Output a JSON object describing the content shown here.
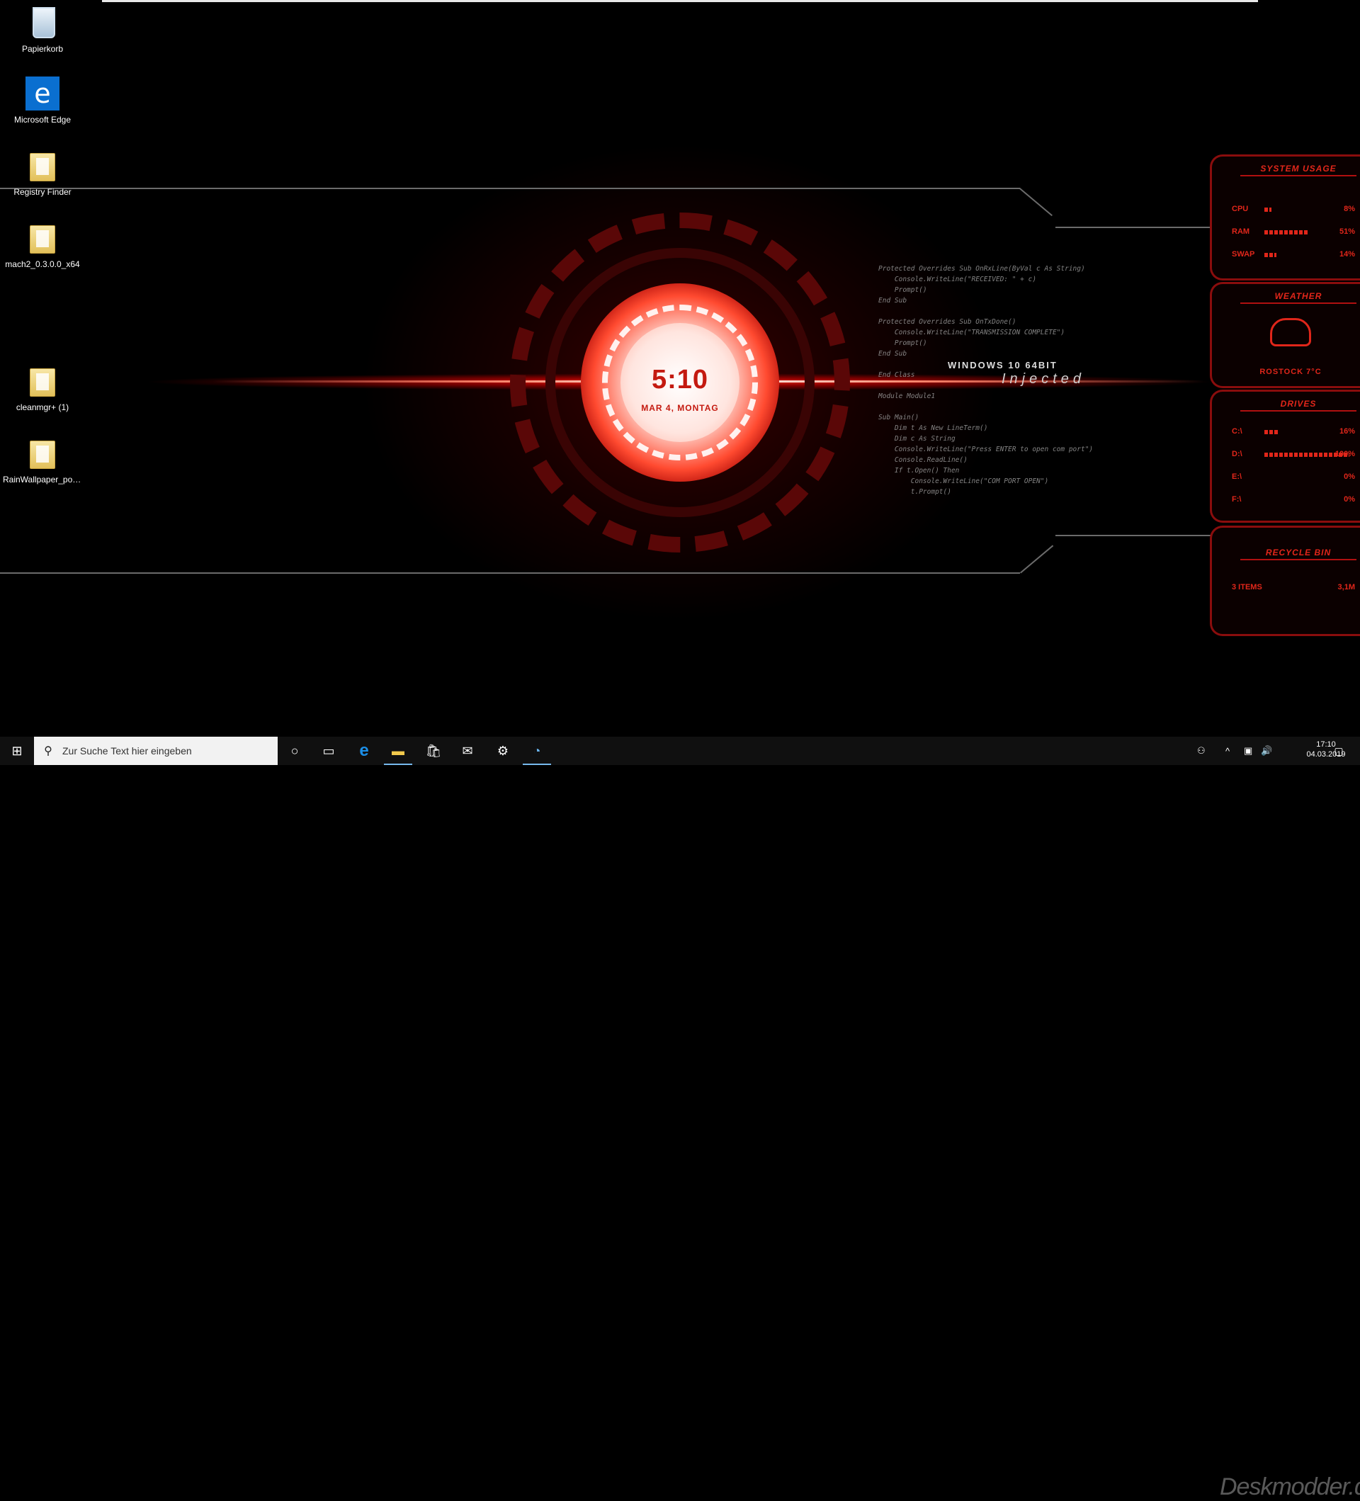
{
  "desktop_icons": [
    {
      "label": "Papierkorb",
      "icon": "recycle-bin-icon"
    },
    {
      "label": "Microsoft Edge",
      "icon": "edge-icon"
    },
    {
      "label": "Registry Finder",
      "icon": "folder-icon"
    },
    {
      "label": "mach2_0.3.0.0_x64",
      "icon": "folder-icon"
    },
    {
      "label": "cleanmgr+ (1)",
      "icon": "folder-icon"
    },
    {
      "label": "RainWallpaper_port...",
      "icon": "folder-icon"
    }
  ],
  "clock_widget": {
    "time": "5:10",
    "date": "MAR 4, MONTAG"
  },
  "wallpaper": {
    "os_text": "WINDOWS 10 64BIT",
    "tagline": "Injected",
    "code_lines": [
      "Protected Overrides Sub OnRxLine(ByVal c As String)",
      "    Console.WriteLine(\"RECEIVED: \" + c)",
      "    Prompt()",
      "End Sub",
      "",
      "Protected Overrides Sub OnTxDone()",
      "    Console.WriteLine(\"TRANSMISSION COMPLETE\")",
      "    Prompt()",
      "End Sub",
      "",
      "End Class",
      "",
      "Module Module1",
      "",
      "Sub Main()",
      "    Dim t As New LineTerm()",
      "    Dim c As String",
      "    Console.WriteLine(\"Press ENTER to open com port\")",
      "    Console.ReadLine()",
      "    If t.Open() Then",
      "        Console.WriteLine(\"COM PORT OPEN\")",
      "        t.Prompt()"
    ]
  },
  "panels": {
    "system_usage": {
      "title": "SYSTEM USAGE",
      "rows": [
        {
          "label": "CPU",
          "value": "8%",
          "fraction": 0.08
        },
        {
          "label": "RAM",
          "value": "51%",
          "fraction": 0.51
        },
        {
          "label": "SWAP",
          "value": "14%",
          "fraction": 0.14
        }
      ]
    },
    "weather": {
      "title": "WEATHER",
      "location": "ROSTOCK 7°C"
    },
    "drives": {
      "title": "DRIVES",
      "rows": [
        {
          "label": "C:\\",
          "value": "16%",
          "fraction": 0.16
        },
        {
          "label": "D:\\",
          "value": "100%",
          "fraction": 1.0
        },
        {
          "label": "E:\\",
          "value": "0%",
          "fraction": 0.0
        },
        {
          "label": "F:\\",
          "value": "0%",
          "fraction": 0.0
        }
      ]
    },
    "recycle_bin": {
      "title": "RECYCLE BIN",
      "items": "3 ITEMS",
      "size": "3,1M"
    }
  },
  "taskbar": {
    "search_placeholder": "Zur Suche Text hier eingeben",
    "clock_time": "17:10",
    "clock_date": "04.03.2019",
    "watermark": "Deskmodder.de"
  },
  "accent_color": "#e0261a"
}
